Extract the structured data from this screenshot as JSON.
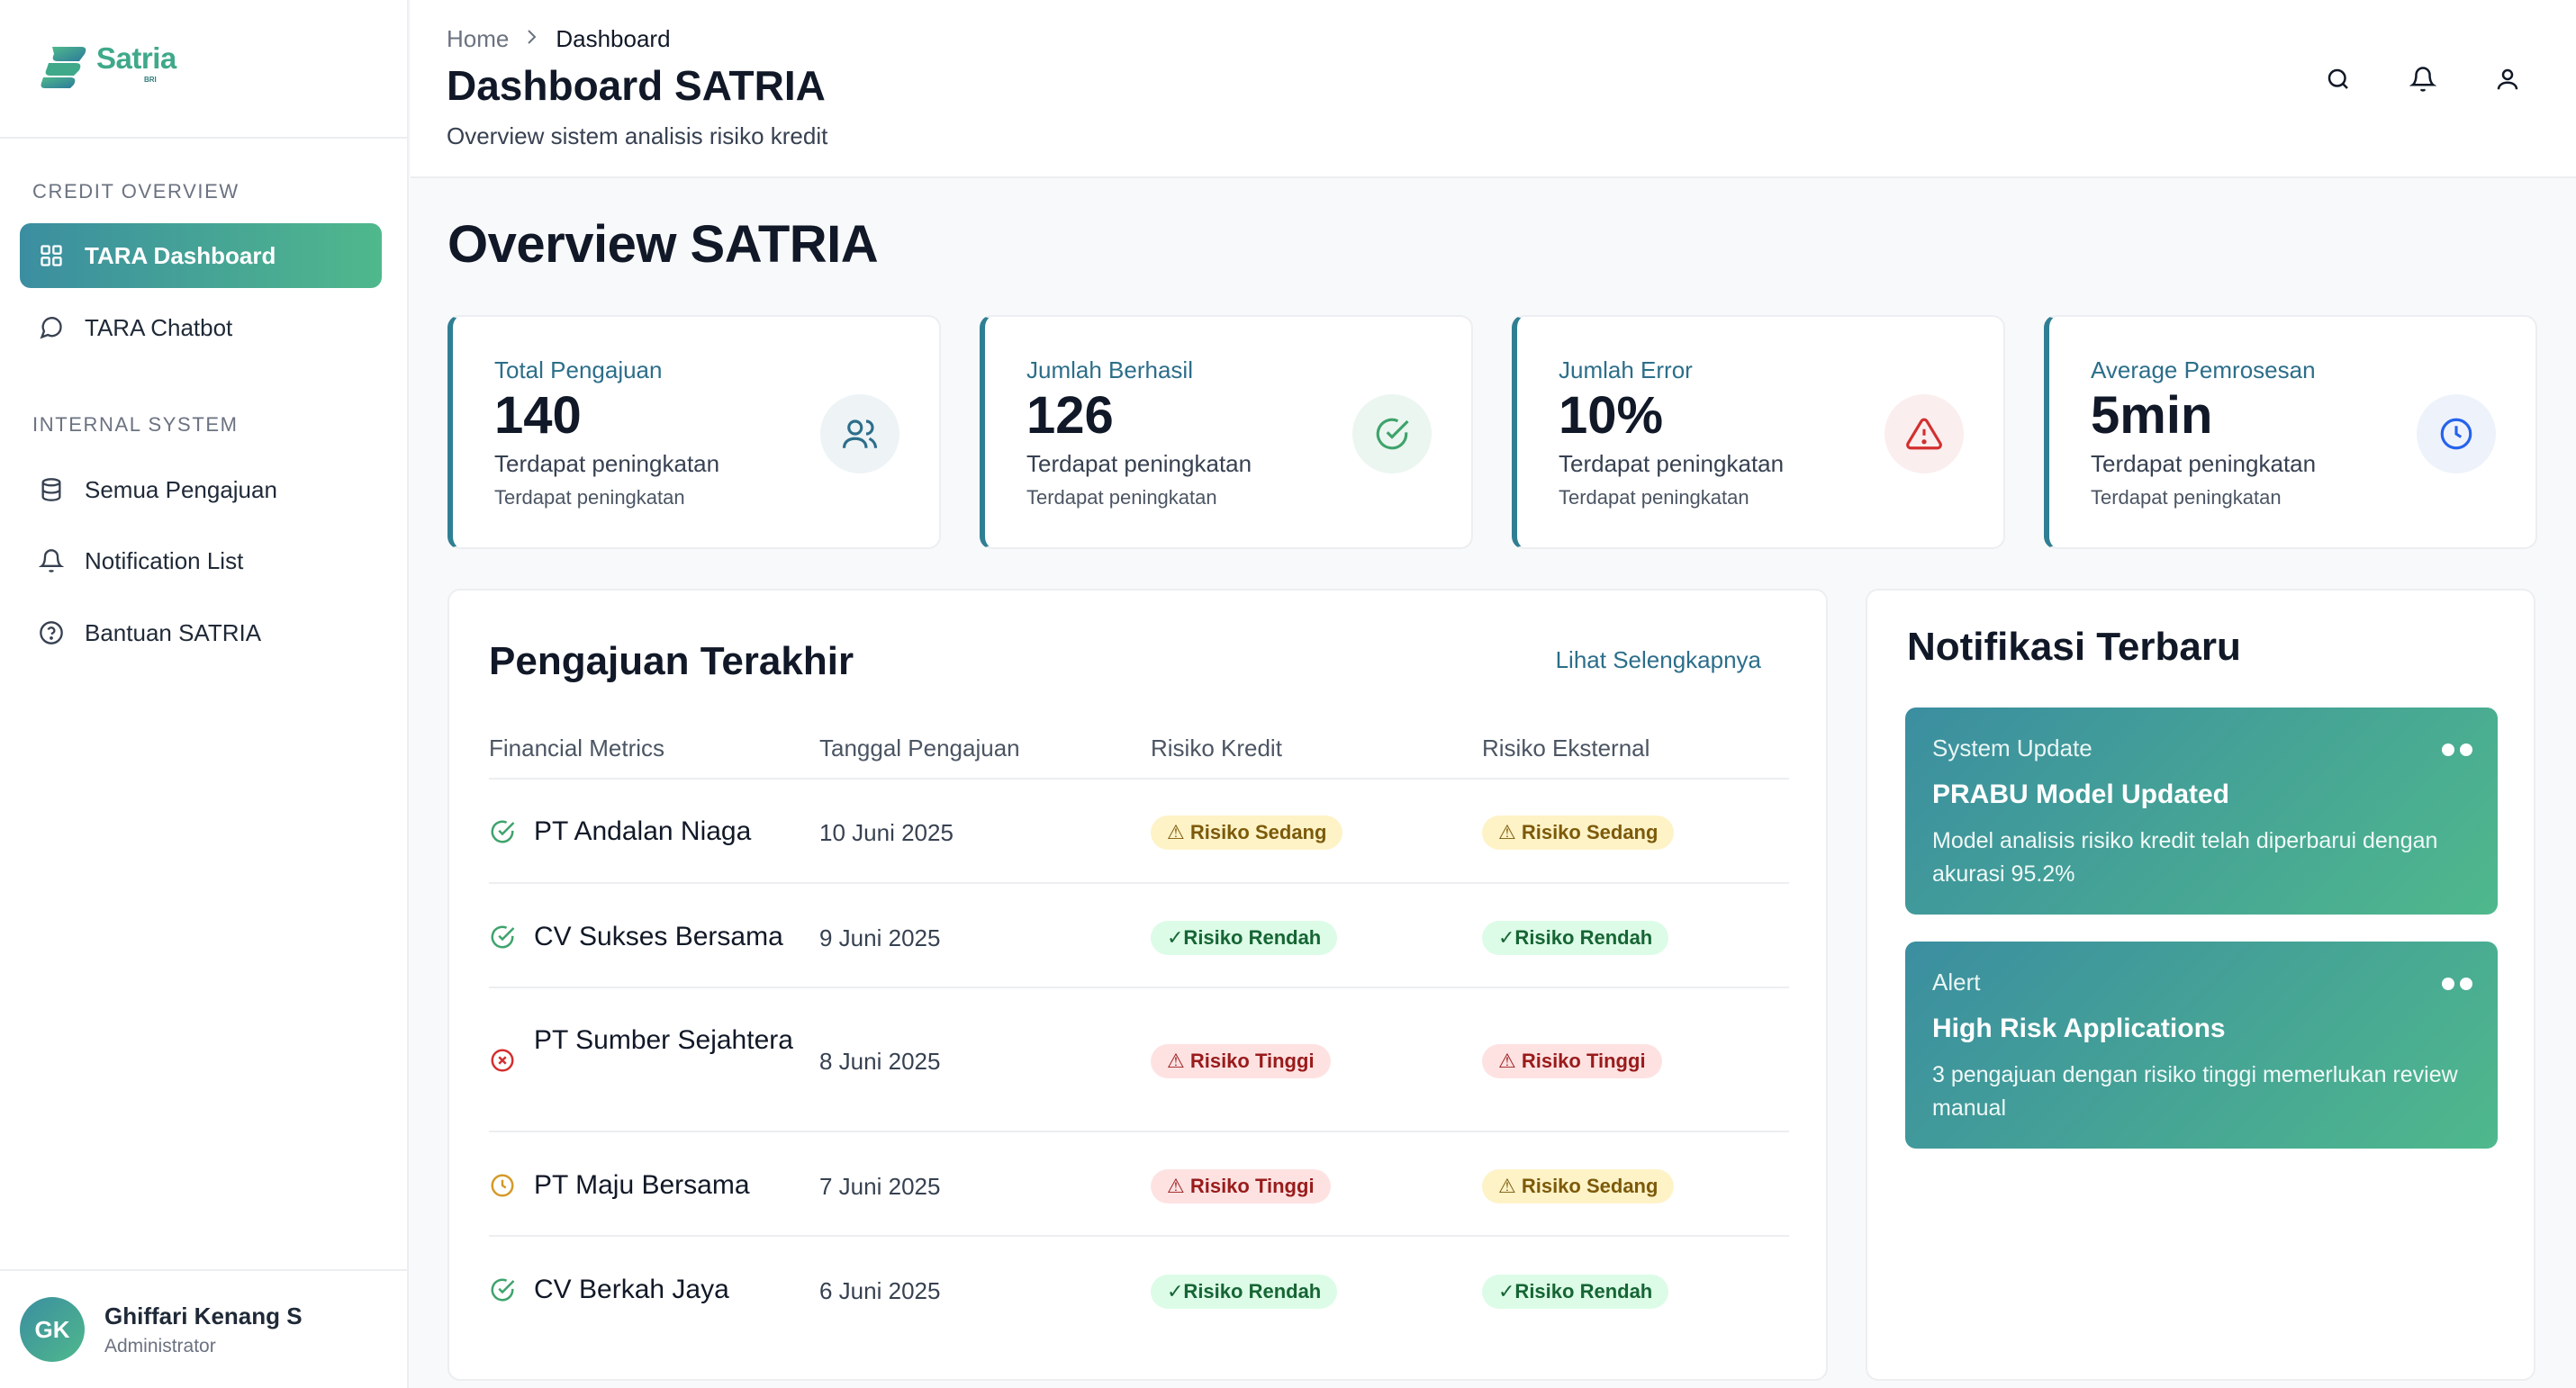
{
  "brand": {
    "name": "Satria",
    "sub": "BRI"
  },
  "sidebar": {
    "section_credit": "CREDIT OVERVIEW",
    "section_internal": "INTERNAL SYSTEM",
    "items": [
      {
        "label": "TARA Dashboard",
        "icon": "grid-icon",
        "active": true
      },
      {
        "label": "TARA Chatbot",
        "icon": "chat-icon",
        "active": false
      },
      {
        "label": "Semua Pengajuan",
        "icon": "database-icon",
        "active": false
      },
      {
        "label": "Notification List",
        "icon": "bell-icon",
        "active": false
      },
      {
        "label": "Bantuan SATRIA",
        "icon": "help-icon",
        "active": false
      }
    ],
    "user": {
      "initials": "GK",
      "name": "Ghiffari Kenang S",
      "role": "Administrator"
    }
  },
  "header": {
    "breadcrumb": {
      "home": "Home",
      "current": "Dashboard"
    },
    "title": "Dashboard SATRIA",
    "subtitle": "Overview sistem analisis risiko kredit",
    "icons": [
      "search-icon",
      "bell-icon",
      "user-icon"
    ]
  },
  "main": {
    "heading": "Overview SATRIA",
    "stats": [
      {
        "label": "Total Pengajuan",
        "value": "140",
        "sub1": "Terdapat peningkatan",
        "sub2": "Terdapat peningkatan",
        "icon": "users-icon",
        "color": "#2c6e8a",
        "bg": "#eef3f6"
      },
      {
        "label": "Jumlah Berhasil",
        "value": "126",
        "sub1": "Terdapat peningkatan",
        "sub2": "Terdapat peningkatan",
        "icon": "check-circle-icon",
        "color": "#3fa36c",
        "bg": "#ecf6f0"
      },
      {
        "label": "Jumlah Error",
        "value": "10%",
        "sub1": "Terdapat peningkatan",
        "sub2": "Terdapat peningkatan",
        "icon": "warning-icon",
        "color": "#d32f2f",
        "bg": "#fbeeee"
      },
      {
        "label": "Average Pemrosesan",
        "value": "5min",
        "sub1": "Terdapat peningkatan",
        "sub2": "Terdapat peningkatan",
        "icon": "clock-icon",
        "color": "#2563eb",
        "bg": "#eef2fb"
      }
    ],
    "recent": {
      "title": "Pengajuan Terakhir",
      "see_more": "Lihat Selengkapnya",
      "columns": [
        "Financial Metrics",
        "Tanggal Pengajuan",
        "Risiko Kredit",
        "Risiko Eksternal"
      ],
      "rows": [
        {
          "name": "PT Andalan Niaga",
          "date": "10 Juni 2025",
          "status": "check",
          "kredit": "⚠ Risiko Sedang",
          "kredit_level": "sedang",
          "eksternal": "⚠ Risiko Sedang",
          "eksternal_level": "sedang"
        },
        {
          "name": "CV Sukses Bersama",
          "date": "9 Juni 2025",
          "status": "check",
          "kredit": "✓Risiko Rendah",
          "kredit_level": "rendah",
          "eksternal": "✓Risiko Rendah",
          "eksternal_level": "rendah"
        },
        {
          "name": "PT Sumber Sejahtera",
          "date": "8 Juni 2025",
          "status": "x",
          "kredit": "⚠ Risiko Tinggi",
          "kredit_level": "tinggi",
          "eksternal": "⚠ Risiko Tinggi",
          "eksternal_level": "tinggi"
        },
        {
          "name": "PT Maju Bersama",
          "date": "7 Juni 2025",
          "status": "clock",
          "kredit": "⚠ Risiko Tinggi",
          "kredit_level": "tinggi",
          "eksternal": "⚠ Risiko Sedang",
          "eksternal_level": "sedang"
        },
        {
          "name": "CV Berkah Jaya",
          "date": "6 Juni 2025",
          "status": "check",
          "kredit": "✓Risiko Rendah",
          "kredit_level": "rendah",
          "eksternal": "✓Risiko Rendah",
          "eksternal_level": "rendah"
        }
      ]
    },
    "notifications": {
      "title": "Notifikasi Terbaru",
      "items": [
        {
          "type": "System Update",
          "title": "PRABU Model Updated",
          "body": "Model analisis risiko kredit telah diperbarui dengan akurasi 95.2%"
        },
        {
          "type": "Alert",
          "title": "High Risk Applications",
          "body": "3 pengajuan dengan risiko tinggi memerlukan review manual"
        }
      ]
    }
  }
}
